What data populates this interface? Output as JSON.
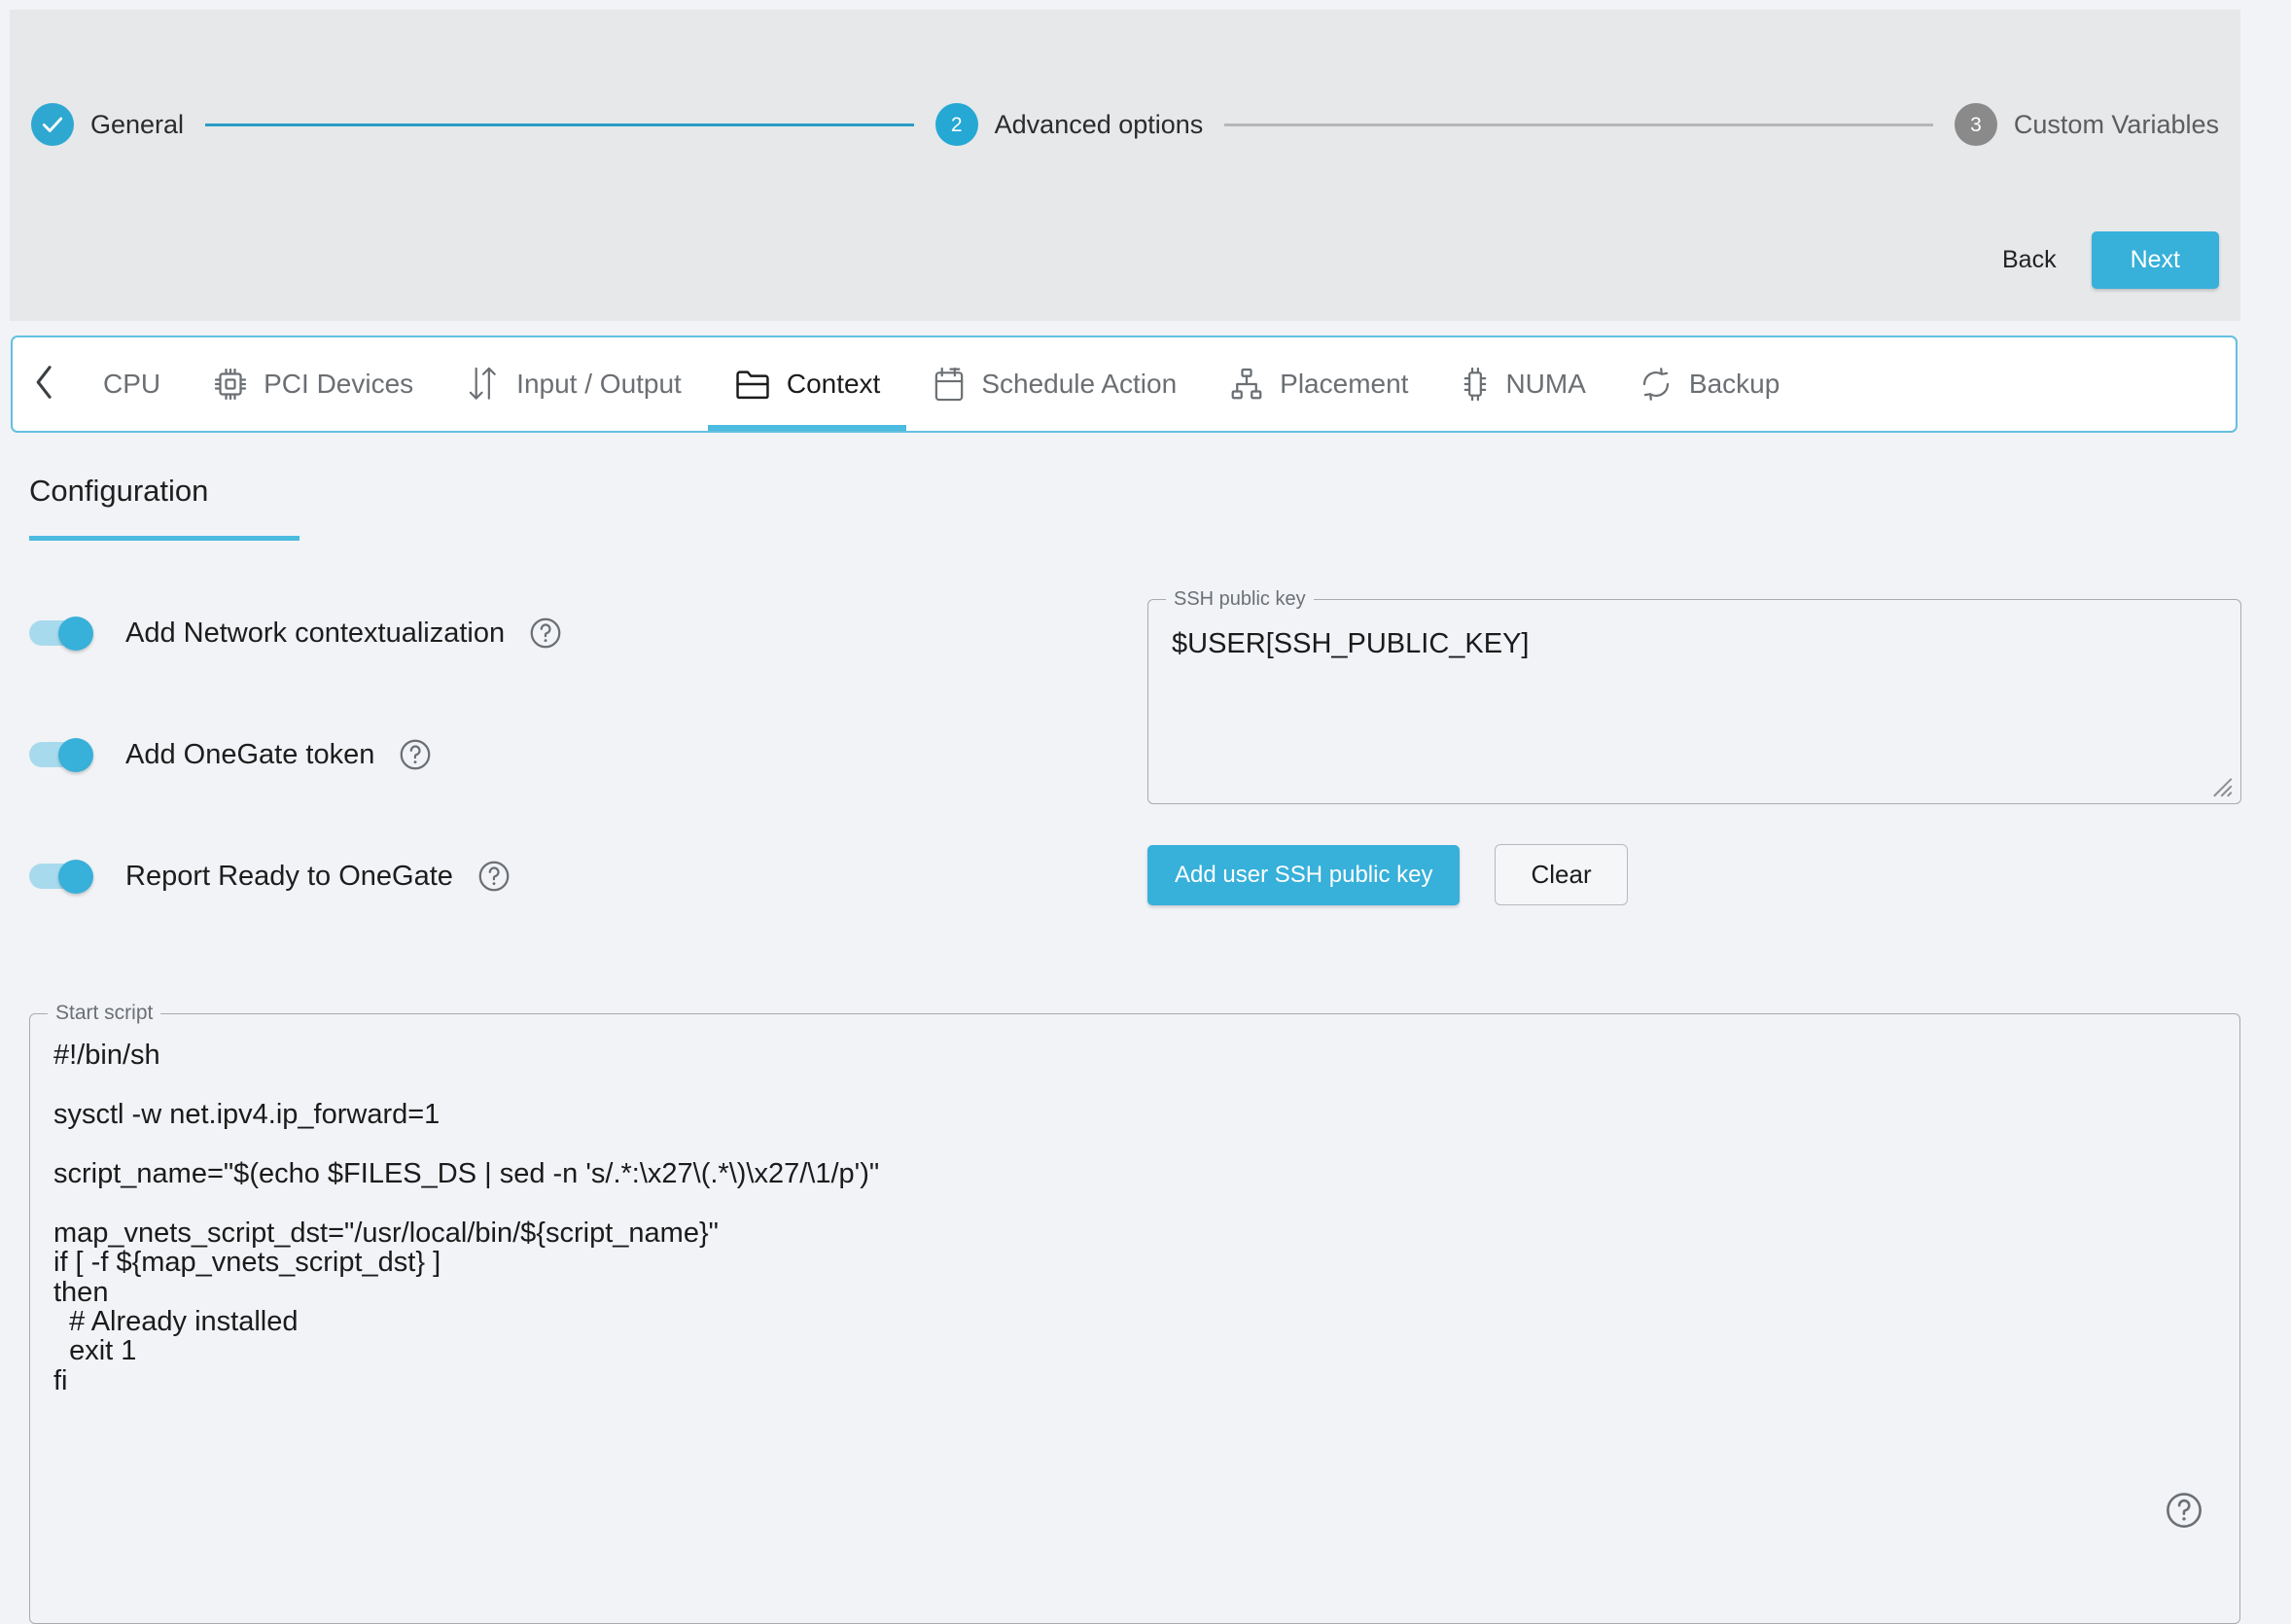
{
  "wizard": {
    "steps": [
      {
        "label": "General",
        "state": "done",
        "marker": "check"
      },
      {
        "label": "Advanced options",
        "state": "active",
        "marker": "2"
      },
      {
        "label": "Custom Variables",
        "state": "inactive",
        "marker": "3"
      }
    ],
    "back_label": "Back",
    "next_label": "Next"
  },
  "tabs": {
    "scroll_left_icon": "chevron-left-icon",
    "items": [
      {
        "label": "CPU",
        "icon": "",
        "active": false
      },
      {
        "label": "PCI Devices",
        "icon": "chip-icon",
        "active": false
      },
      {
        "label": "Input / Output",
        "icon": "arrows-updown-icon",
        "active": false
      },
      {
        "label": "Context",
        "icon": "folder-icon",
        "active": true
      },
      {
        "label": "Schedule Action",
        "icon": "calendar-icon",
        "active": false
      },
      {
        "label": "Placement",
        "icon": "sitemap-icon",
        "active": false
      },
      {
        "label": "NUMA",
        "icon": "numa-chip-icon",
        "active": false
      },
      {
        "label": "Backup",
        "icon": "refresh-icon",
        "active": false
      }
    ]
  },
  "configuration": {
    "title": "Configuration",
    "toggles": [
      {
        "label": "Add Network contextualization",
        "on": true,
        "help": "?"
      },
      {
        "label": "Add OneGate token",
        "on": true,
        "help": "?"
      },
      {
        "label": "Report Ready to OneGate",
        "on": true,
        "help": "?"
      }
    ]
  },
  "ssh": {
    "legend": "SSH public key",
    "value": "$USER[SSH_PUBLIC_KEY]",
    "placeholder": "",
    "add_button_label": "Add user SSH public key",
    "clear_button_label": "Clear"
  },
  "start_script": {
    "legend": "Start script",
    "help": "?",
    "value": "#!/bin/sh\n\nsysctl -w net.ipv4.ip_forward=1\n\nscript_name=\"$(echo $FILES_DS | sed -n 's/.*:\\x27\\(.*\\)\\x27/\\1/p')\"\n\nmap_vnets_script_dst=\"/usr/local/bin/${script_name}\"\nif [ -f ${map_vnets_script_dst} ]\nthen\n  # Already installed\n  exit 1\nfi"
  },
  "colors": {
    "accent": "#37b0da",
    "accent_line": "#2b9cc4",
    "header_bg": "#e6e8ea",
    "page_bg": "#f1f3f6",
    "tab_border": "#63c0e0",
    "inactive_step": "#8a8a8a"
  }
}
